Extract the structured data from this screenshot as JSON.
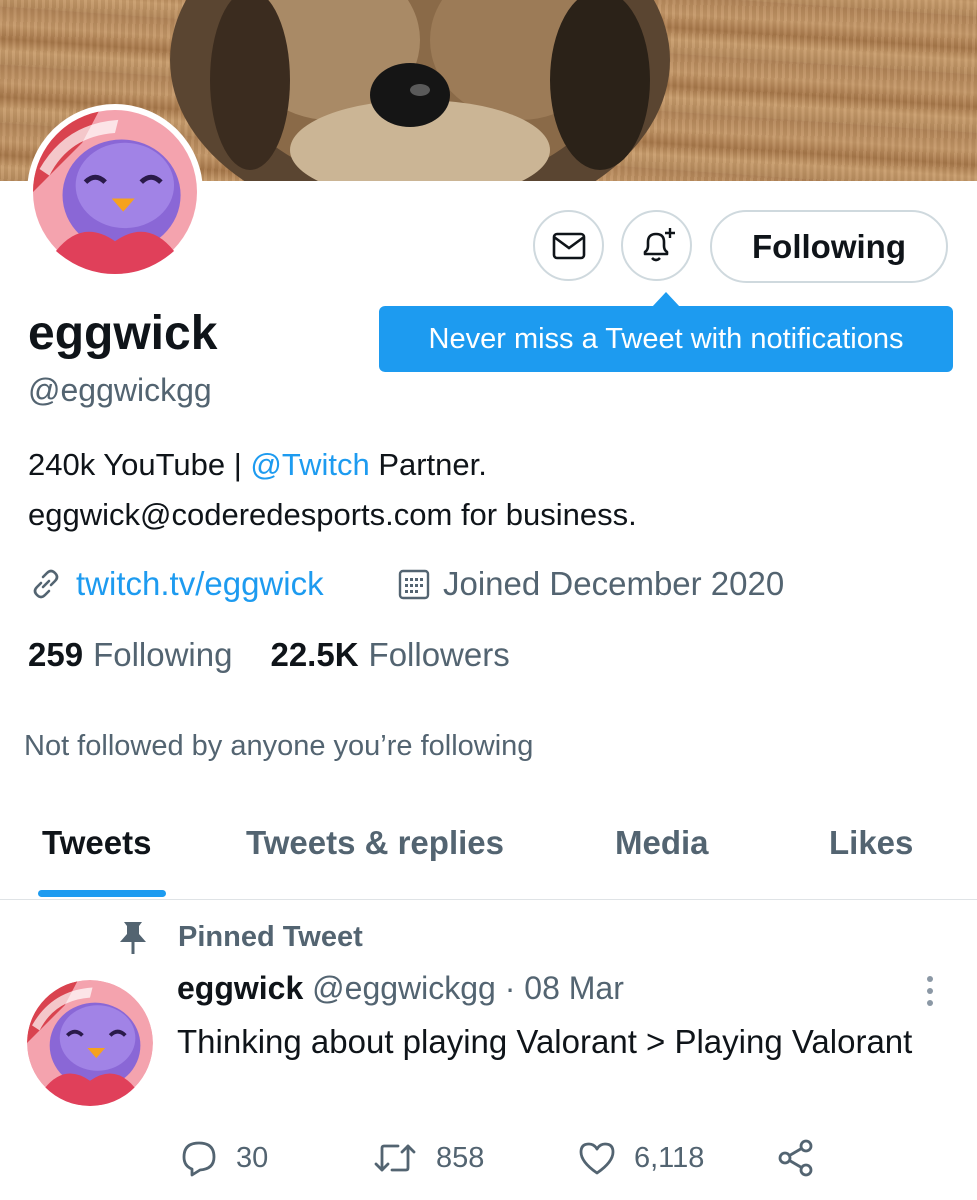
{
  "profile": {
    "name": "eggwick",
    "handle": "@eggwickgg",
    "bio_part1": "240k YouTube | ",
    "bio_mention": "@Twitch",
    "bio_part2": " Partner.",
    "bio_line2": "eggwick@coderedesports.com for business.",
    "website": "twitch.tv/eggwick",
    "joined": "Joined December 2020",
    "following_count": "259",
    "following_label": "Following",
    "followers_count": "22.5K",
    "followers_label": "Followers",
    "not_followed": "Not followed by anyone you’re following"
  },
  "actions": {
    "message_icon": "mail-icon",
    "notify_icon": "bell-plus-icon",
    "follow_button": "Following",
    "tooltip": "Never miss a Tweet with notifications"
  },
  "tabs": [
    {
      "label": "Tweets",
      "active": true
    },
    {
      "label": "Tweets & replies",
      "active": false
    },
    {
      "label": "Media",
      "active": false
    },
    {
      "label": "Likes",
      "active": false
    }
  ],
  "pinned_tweet": {
    "pinned_label": "Pinned Tweet",
    "author": "eggwick",
    "meta": "@eggwickgg · 08 Mar",
    "text": "Thinking about playing Valorant > Playing Valorant",
    "replies": "30",
    "retweets": "858",
    "likes": "6,118"
  },
  "colors": {
    "accent": "#1d9bf0",
    "text_primary": "#0f1419",
    "text_secondary": "#536471",
    "border": "#cfd9de"
  }
}
